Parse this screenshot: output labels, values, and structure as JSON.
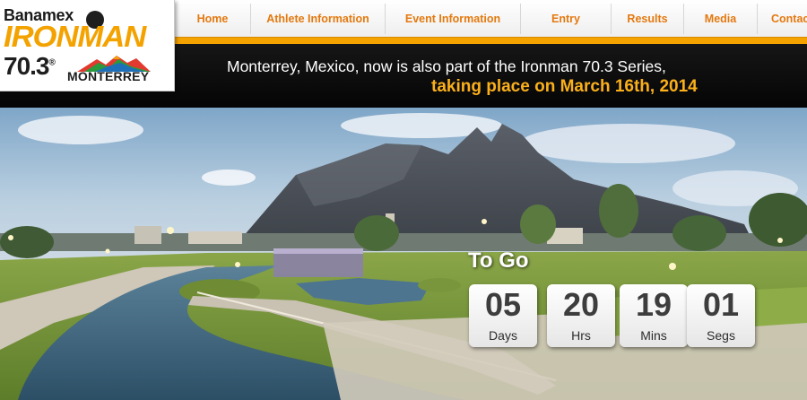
{
  "logo": {
    "sponsor": "Banamex",
    "brand": "IRONMAN",
    "series": "70.3",
    "registered": "®",
    "city": "MONTERREY"
  },
  "nav": {
    "items": [
      {
        "label": "Home"
      },
      {
        "label": "Athlete Information"
      },
      {
        "label": "Event Information"
      },
      {
        "label": "Entry"
      },
      {
        "label": "Results"
      },
      {
        "label": "Media"
      },
      {
        "label": "Contac"
      }
    ]
  },
  "banner": {
    "line1": "Monterrey, Mexico, now is also part of the Ironman 70.3 Series,",
    "line2": "taking place on March 16th, 2014"
  },
  "countdown": {
    "title": "To Go",
    "units": [
      {
        "value": "05",
        "label": "Days"
      },
      {
        "value": "20",
        "label": "Hrs"
      },
      {
        "value": "19",
        "label": "Mins"
      },
      {
        "value": "01",
        "label": "Segs"
      }
    ]
  },
  "colors": {
    "accent": "#f5a300",
    "nav_text": "#e4790f",
    "banner_highlight": "#fbb01a"
  }
}
